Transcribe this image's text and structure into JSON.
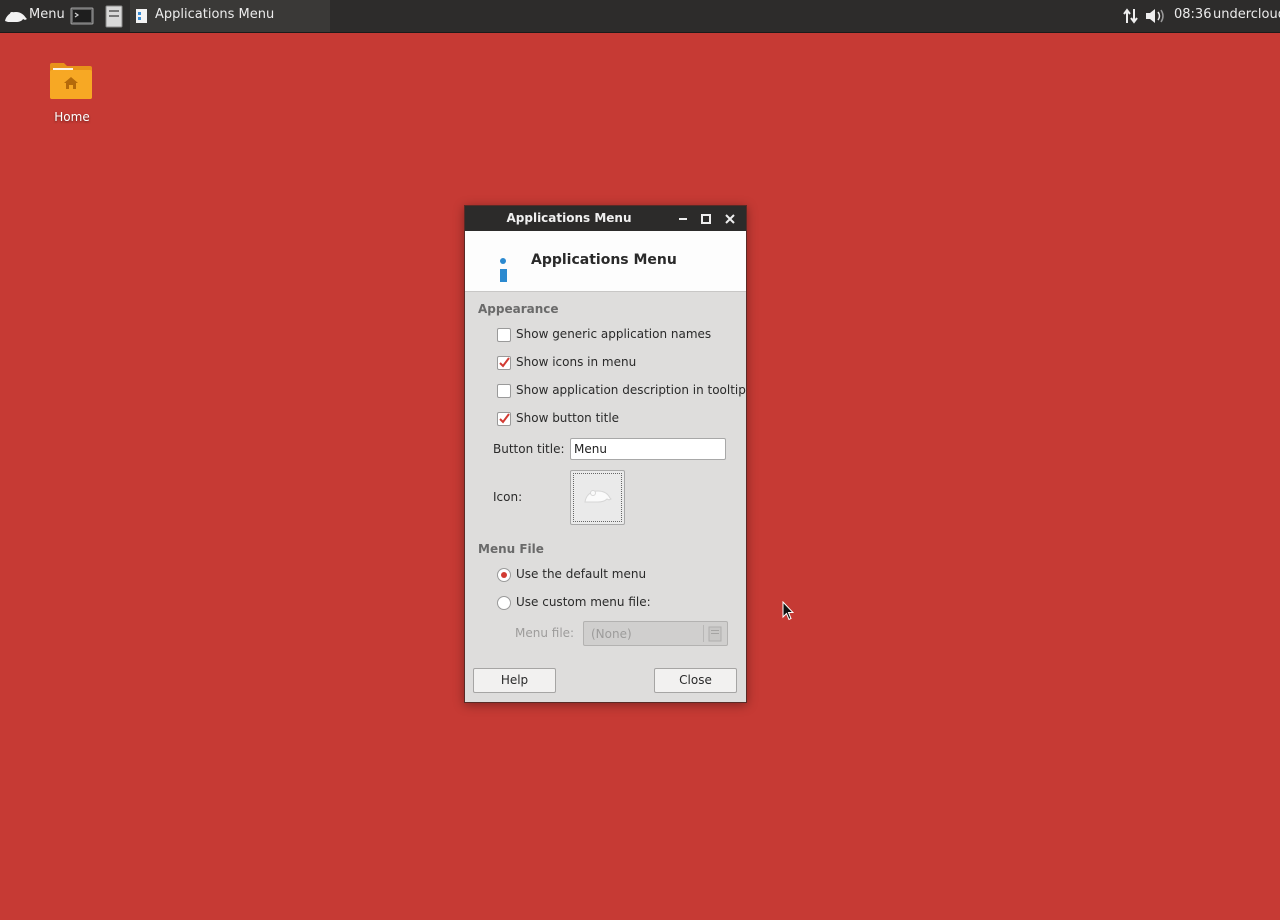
{
  "panel": {
    "menu_label": "Menu",
    "launchers": [
      "terminal-icon",
      "file-manager-icon"
    ],
    "task_label": "Applications Menu",
    "clock": "08:36",
    "user": "undercloud",
    "tray_icons": [
      "network-icon",
      "volume-icon"
    ]
  },
  "desktop": {
    "home_label": "Home"
  },
  "dialog": {
    "window_title": "Applications Menu",
    "header_title": "Applications Menu",
    "appearance": {
      "heading": "Appearance",
      "options": [
        {
          "label": "Show generic application names",
          "checked": false
        },
        {
          "label": "Show icons in menu",
          "checked": true
        },
        {
          "label": "Show application description in tooltip",
          "checked": false
        },
        {
          "label": "Show button title",
          "checked": true
        }
      ],
      "button_title_label": "Button title:",
      "button_title_value": "Menu",
      "icon_label": "Icon:"
    },
    "menu_file": {
      "heading": "Menu File",
      "default_label": "Use the default menu",
      "custom_label": "Use custom menu file:",
      "selected": "default",
      "file_label": "Menu file:",
      "file_value": "(None)"
    },
    "help_label": "Help",
    "close_label": "Close"
  },
  "colors": {
    "desktop_bg": "#c63a34",
    "accent": "#d23b33",
    "panel_bg": "#2d2c2b"
  }
}
